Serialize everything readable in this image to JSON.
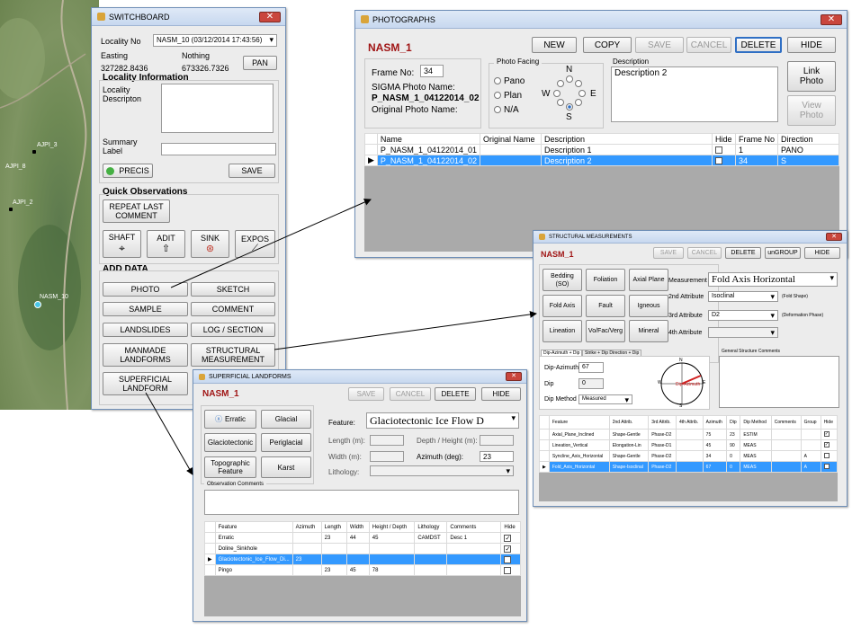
{
  "map": {
    "labels": [
      "AJPI_3",
      "AJPI_8",
      "AJPI_2",
      "NASM_10"
    ]
  },
  "switchboard": {
    "title": "SWITCHBOARD",
    "locality_label": "Locality No",
    "locality_value": "NASM_10   (03/12/2014 17:43:56)",
    "easting_label": "Easting",
    "northing_label": "Nothing",
    "easting_value": "327282.8436",
    "northing_value": "673326.7326",
    "pan_label": "PAN",
    "locality_info_heading": "Locality Information",
    "locality_desc_label": "Locality\nDescripton",
    "summary_label": "Summary\nLabel",
    "precis_label": "PRECIS",
    "save_label": "SAVE",
    "quick_obs_heading": "Quick Observations",
    "repeat_label": "REPEAT LAST\nCOMMENT",
    "shaft_label": "SHAFT",
    "adit_label": "ADIT",
    "sink_label": "SINK",
    "expos_label": "EXPOS",
    "add_data_heading": "ADD DATA",
    "add_buttons": [
      "PHOTO",
      "SKETCH",
      "SAMPLE",
      "COMMENT",
      "LANDSLIDES",
      "LOG / SECTION",
      "MANMADE\nLANDFORMS",
      "STRUCTURAL\nMEASUREMENT",
      "SUPERFICIAL\nLANDFORM"
    ]
  },
  "photographs": {
    "title": "PHOTOGRAPHS",
    "header": "NASM_1",
    "buttons": {
      "new": "NEW",
      "copy": "COPY",
      "save": "SAVE",
      "cancel": "CANCEL",
      "delete": "DELETE",
      "hide": "HIDE"
    },
    "frame_label": "Frame No:",
    "frame_value": "34",
    "sigma_label": "SIGMA Photo Name:",
    "sigma_value": "P_NASM_1_04122014_02",
    "orig_label": "Original Photo Name:",
    "facing_label": "Photo Facing",
    "facing_options": [
      "Pano",
      "Plan",
      "N/A"
    ],
    "compass": {
      "n": "N",
      "s": "S",
      "e": "E",
      "w": "W"
    },
    "description_label": "Description",
    "description_value": "Description 2",
    "link_label": "Link\nPhoto",
    "view_label": "View\nPhoto",
    "table": {
      "headers": [
        "Name",
        "Original Name",
        "Description",
        "Hide",
        "Frame No",
        "Direction"
      ],
      "rows": [
        {
          "name": "P_NASM_1_04122014_01",
          "orig": "",
          "desc": "Description 1",
          "frame": "1",
          "dir": "PANO"
        },
        {
          "name": "P_NASM_1_04122014_02",
          "orig": "",
          "desc": "Description 2",
          "frame": "34",
          "dir": "S"
        }
      ]
    }
  },
  "structural": {
    "title": "STRUCTURAL MEASUREMENTS",
    "header": "NASM_1",
    "buttons": {
      "save": "SAVE",
      "cancel": "CANCEL",
      "delete": "DELETE",
      "ungroup": "unGROUP",
      "hide": "HIDE"
    },
    "feature_buttons": [
      "Bedding\n(SO)",
      "Foliation",
      "Axial Plane",
      "Fold Axis",
      "Fault",
      "Igneous",
      "Lineation",
      "Vo/Fac/Verg",
      "Mineral"
    ],
    "measurement_label": "Measurement",
    "measurement_value": "Fold Axis Horizontal",
    "attr2_label": "2nd Attribute",
    "attr2_value": "Isoclinal",
    "attr2_note": "(Fold Shape)",
    "attr3_label": "3rd Attribute",
    "attr3_value": "D2",
    "attr3_note": "(Deformation Phase)",
    "attr4_label": "4th Attribute",
    "tab1": "Dip-Azimuth + Dip",
    "tab2": "Strike + Dip Direction + Dip",
    "dipaz_label": "Dip-Azimuth",
    "dipaz_value": "67",
    "dip_label": "Dip",
    "dip_value": "0",
    "dipmethod_label": "Dip Method",
    "dipmethod_value": "Measured",
    "compass_label": "Dip-Azimuth",
    "compass": {
      "n": "N",
      "s": "S",
      "e": "E",
      "w": "W"
    },
    "general_label": "General Structure Comments",
    "table": {
      "headers": [
        "Feature",
        "2nd Attrib.",
        "3rd Attrib.",
        "4th Attrib.",
        "Azimuth",
        "Dip",
        "Dip Method",
        "Comments",
        "Group",
        "Hide"
      ],
      "rows": [
        {
          "f": "Axial_Plane_Inclined",
          "a2": "Shape-Gentle",
          "a3": "Phase-D2",
          "a4": "",
          "az": "75",
          "dip": "23",
          "m": "ESTIM",
          "c": "",
          "g": "",
          "hide": "✓"
        },
        {
          "f": "Lineation_Vertical",
          "a2": "Elongation-Lin",
          "a3": "Phase-D1",
          "a4": "",
          "az": "45",
          "dip": "90",
          "m": "MEAS",
          "c": "",
          "g": "",
          "hide": "✓"
        },
        {
          "f": "Syncline_Axis_Horizontal",
          "a2": "Shape-Gentle",
          "a3": "Phase-D2",
          "a4": "",
          "az": "34",
          "dip": "0",
          "m": "MEAS",
          "c": "",
          "g": "A",
          "hide": ""
        },
        {
          "f": "Fold_Axis_Horizontal",
          "a2": "Shape-Isoclinal",
          "a3": "Phase-D2",
          "a4": "",
          "az": "67",
          "dip": "0",
          "m": "MEAS",
          "c": "",
          "g": "A",
          "hide": ""
        }
      ]
    }
  },
  "superficial": {
    "title": "SUPERFICIAL LANDFORMS",
    "header": "NASM_1",
    "buttons": {
      "save": "SAVE",
      "cancel": "CANCEL",
      "delete": "DELETE",
      "hide": "HIDE"
    },
    "feature_buttons": [
      "Erratic",
      "Glacial",
      "Glaciotectonic",
      "Periglacial",
      "Topographic\nFeature",
      "Karst"
    ],
    "feature_label": "Feature:",
    "feature_value": "Glaciotectonic Ice Flow D",
    "length_label": "Length (m):",
    "depth_label": "Depth / Height (m):",
    "width_label": "Width (m):",
    "azimuth_label": "Azimuth (deg):",
    "azimuth_value": "23",
    "lithology_label": "Lithology:",
    "obs_label": "Observation Comments",
    "table": {
      "headers": [
        "Feature",
        "Azimuth",
        "Length",
        "Width",
        "Height / Depth",
        "Lithology",
        "Comments",
        "Hide"
      ],
      "rows": [
        {
          "f": "Erratic",
          "az": "",
          "l": "23",
          "w": "44",
          "h": "45",
          "lith": "CAMDST",
          "c": "Desc 1",
          "hide": "✓"
        },
        {
          "f": "Doline_Sinkhole",
          "az": "",
          "l": "",
          "w": "",
          "h": "",
          "lith": "",
          "c": "",
          "hide": "✓"
        },
        {
          "f": "Glaciotectonic_Ice_Flow_Di...",
          "az": "23",
          "l": "",
          "w": "",
          "h": "",
          "lith": "",
          "c": "",
          "hide": ""
        },
        {
          "f": "Pingo",
          "az": "",
          "l": "23",
          "w": "45",
          "h": "78",
          "lith": "",
          "c": "",
          "hide": ""
        }
      ]
    }
  }
}
